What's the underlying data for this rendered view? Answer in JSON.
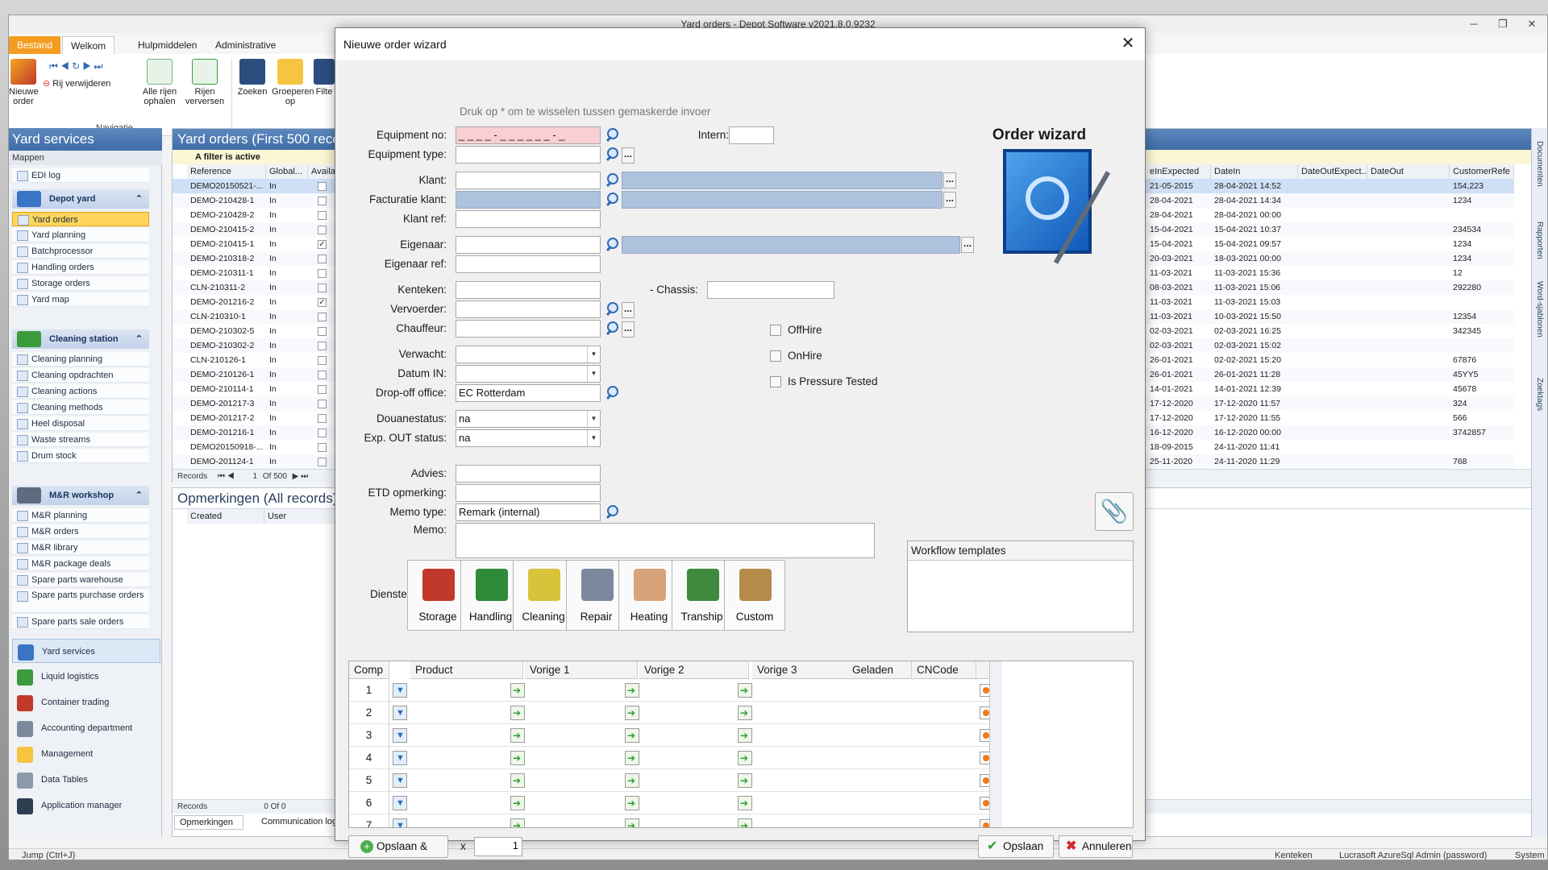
{
  "app": {
    "title": "Yard orders - Depot Software v2021.8.0.9232"
  },
  "ribbon": {
    "tabs": [
      "Bestand",
      "Welkom",
      "Hulpmiddelen",
      "Administrative"
    ],
    "buttons": {
      "new_order": "Nieuwe order",
      "delete_row": "Rij verwijderen",
      "fetch_all": "Alle rijen ophalen",
      "refresh": "Rijen verversen",
      "search": "Zoeken",
      "group": "Groeperen op",
      "filter": "Filte"
    },
    "group_label": "Navigatie"
  },
  "sidebar": {
    "title": "Yard services",
    "folders": "Mappen",
    "edi": "EDI log",
    "depot_group": "Depot yard",
    "depot_items": [
      "Yard orders",
      "Yard planning",
      "Batchprocessor",
      "Handling orders",
      "Storage orders",
      "Yard map"
    ],
    "cleaning_group": "Cleaning station",
    "cleaning_items": [
      "Cleaning planning",
      "Cleaning opdrachten",
      "Cleaning actions",
      "Cleaning methods",
      "Heel disposal",
      "Waste streams",
      "Drum stock"
    ],
    "mr_group": "M&R workshop",
    "mr_items": [
      "M&R planning",
      "M&R orders",
      "M&R library",
      "M&R package deals",
      "Spare parts warehouse",
      "Spare parts purchase orders",
      "Spare parts sale orders"
    ],
    "modules": [
      "Yard services",
      "Liquid logistics",
      "Container trading",
      "Accounting department",
      "Management",
      "Data Tables",
      "Application manager"
    ]
  },
  "yard": {
    "title": "Yard orders   (First 500 reco",
    "filter": "A filter is active",
    "columns": [
      "Reference",
      "Global...",
      "Availab"
    ],
    "right_columns": [
      "eInExpected",
      "DateIn",
      "DateOutExpect...",
      "DateOut",
      "CustomerRefe"
    ],
    "rows": [
      {
        "ref": "DEMO20150521-...",
        "g": "In",
        "chk": "",
        "e": "21-05-2015",
        "d": "28-04-2021 14:52",
        "c": "154,223"
      },
      {
        "ref": "DEMO-210428-1",
        "g": "In",
        "chk": "",
        "e": "28-04-2021",
        "d": "28-04-2021 14:34",
        "c": "1234"
      },
      {
        "ref": "DEMO-210428-2",
        "g": "In",
        "chk": "",
        "e": "28-04-2021",
        "d": "28-04-2021 00:00",
        "c": ""
      },
      {
        "ref": "DEMO-210415-2",
        "g": "In",
        "chk": "",
        "e": "15-04-2021",
        "d": "15-04-2021 10:37",
        "c": "234534"
      },
      {
        "ref": "DEMO-210415-1",
        "g": "In",
        "chk": "✓",
        "e": "15-04-2021",
        "d": "15-04-2021 09:57",
        "c": "1234"
      },
      {
        "ref": "DEMO-210318-2",
        "g": "In",
        "chk": "",
        "e": "20-03-2021",
        "d": "18-03-2021 00:00",
        "c": "1234"
      },
      {
        "ref": "DEMO-210311-1",
        "g": "In",
        "chk": "",
        "e": "11-03-2021",
        "d": "11-03-2021 15:36",
        "c": "12"
      },
      {
        "ref": "CLN-210311-2",
        "g": "In",
        "chk": "",
        "e": "08-03-2021",
        "d": "11-03-2021 15:06",
        "c": "292280"
      },
      {
        "ref": "DEMO-201216-2",
        "g": "In",
        "chk": "✓",
        "e": "11-03-2021",
        "d": "11-03-2021 15:03",
        "c": ""
      },
      {
        "ref": "CLN-210310-1",
        "g": "In",
        "chk": "",
        "e": "11-03-2021",
        "d": "10-03-2021 15:50",
        "c": "12354"
      },
      {
        "ref": "DEMO-210302-5",
        "g": "In",
        "chk": "",
        "e": "02-03-2021",
        "d": "02-03-2021 16:25",
        "c": "342345"
      },
      {
        "ref": "DEMO-210302-2",
        "g": "In",
        "chk": "",
        "e": "02-03-2021",
        "d": "02-03-2021 15:02",
        "c": ""
      },
      {
        "ref": "CLN-210126-1",
        "g": "In",
        "chk": "",
        "e": "26-01-2021",
        "d": "02-02-2021 15:20",
        "c": "67876"
      },
      {
        "ref": "DEMO-210126-1",
        "g": "In",
        "chk": "",
        "e": "26-01-2021",
        "d": "26-01-2021 11:28",
        "c": "45YY5"
      },
      {
        "ref": "DEMO-210114-1",
        "g": "In",
        "chk": "",
        "e": "14-01-2021",
        "d": "14-01-2021 12:39",
        "c": "45678"
      },
      {
        "ref": "DEMO-201217-3",
        "g": "In",
        "chk": "",
        "e": "17-12-2020",
        "d": "17-12-2020 11:57",
        "c": "324"
      },
      {
        "ref": "DEMO-201217-2",
        "g": "In",
        "chk": "",
        "e": "17-12-2020",
        "d": "17-12-2020 11:55",
        "c": "566"
      },
      {
        "ref": "DEMO-201216-1",
        "g": "In",
        "chk": "",
        "e": "16-12-2020",
        "d": "16-12-2020 00:00",
        "c": "3742857"
      },
      {
        "ref": "DEMO20150918-...",
        "g": "In",
        "chk": "",
        "e": "18-09-2015",
        "d": "24-11-2020 11:41",
        "c": ""
      },
      {
        "ref": "DEMO-201124-1",
        "g": "In",
        "chk": "",
        "e": "25-11-2020",
        "d": "24-11-2020 11:29",
        "c": "768"
      }
    ],
    "records": "Records",
    "rec_of": "Of 500",
    "rec_num": "1"
  },
  "memos": {
    "title": "Opmerkingen   (All records)",
    "cols": [
      "Created",
      "User"
    ],
    "records": "Records",
    "rec_of": "0 Of 0",
    "tabs": [
      "Opmerkingen",
      "Communication log"
    ]
  },
  "rightstrip": [
    "Documenten",
    "Rapporten",
    "Word-sjablonen",
    "Zoektags"
  ],
  "status": {
    "jump": "Jump  (Ctrl+J)",
    "kenteken": "Kenteken",
    "user": "Lucrasoft AzureSql Admin (password)",
    "system": "System"
  },
  "dialog": {
    "title": "Nieuwe order wizard",
    "hint": "Druk op * om te wisselen tussen gemaskerde invoer",
    "wizard_title": "Order wizard",
    "labels": {
      "equipment_no": "Equipment no:",
      "equipment_type": "Equipment type:",
      "intern": "Intern:",
      "klant": "Klant:",
      "facturatie": "Facturatie klant:",
      "klant_ref": "Klant ref:",
      "eigenaar": "Eigenaar:",
      "eigenaar_ref": "Eigenaar ref:",
      "kenteken": "Kenteken:",
      "chassis": "- Chassis:",
      "vervoerder": "Vervoerder:",
      "chauffeur": "Chauffeur:",
      "verwacht": "Verwacht:",
      "datum_in": "Datum IN:",
      "dropoff": "Drop-off office:",
      "douane": "Douanestatus:",
      "exp_out": "Exp. OUT status:",
      "advies": "Advies:",
      "etd": "ETD opmerking:",
      "memo_type": "Memo type:",
      "memo": "Memo:",
      "diensten": "Diensten:"
    },
    "values": {
      "equipment_no": "_ _ _ _ - _ _ _ _ _ _ - _",
      "dropoff": "EC Rotterdam",
      "douane": "na",
      "exp_out": "na",
      "memo_type": "Remark (internal)"
    },
    "checks": [
      "OffHire",
      "OnHire",
      "Is Pressure Tested"
    ],
    "workflow": "Workflow templates",
    "services": [
      "Storage",
      "Handling",
      "Cleaning",
      "Repair",
      "Heating",
      "Tranship",
      "Custom"
    ],
    "grid_cols": [
      "Comp",
      "Product",
      "Vorige 1",
      "Vorige 2",
      "Vorige 3",
      "Geladen",
      "CNCode"
    ],
    "grid_rows": [
      "1",
      "2",
      "3",
      "4",
      "5",
      "6",
      "7"
    ],
    "save_and": "Opslaan &",
    "times": "x",
    "qty": "1",
    "save": "Opslaan",
    "cancel": "Annuleren"
  }
}
